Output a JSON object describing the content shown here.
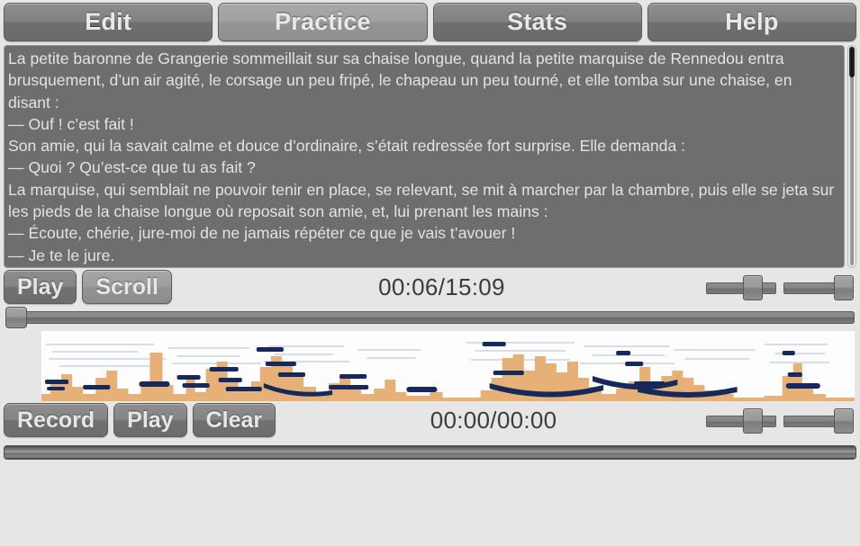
{
  "tabs": [
    {
      "label": "Edit",
      "active": false
    },
    {
      "label": "Practice",
      "active": true
    },
    {
      "label": "Stats",
      "active": false
    },
    {
      "label": "Help",
      "active": false
    }
  ],
  "reading_panel": {
    "text": "La petite baronne de Grangerie sommeillait sur sa chaise longue, quand la petite marquise de Rennedou entra brusquement, d’un air agité, le corsage un peu fripé, le chapeau un peu tourné, et elle tomba sur une chaise, en disant :\n— Ouf ! c’est fait !\nSon amie, qui la savait calme et douce d’ordinaire, s’était redressée fort surprise. Elle demanda :\n— Quoi ? Qu’est-ce que tu as fait ?\nLa marquise, qui semblait ne pouvoir tenir en place, se relevant, se mit à marcher par la chambre, puis elle se jeta sur les pieds de la chaise longue où reposait son amie, et, lui prenant les mains :\n— Écoute, chérie, jure-moi de ne jamais répéter ce que je vais t’avouer !\n— Je te le jure.\n— Sur ton salut éternel ?",
    "scrollbar_position_percent": 2
  },
  "playback_row": {
    "play_label": "Play",
    "scroll_label": "Scroll",
    "time": "00:06/15:09",
    "slider_a_percent": 55,
    "slider_b_percent": 100
  },
  "seek_slider": {
    "position_percent": 0
  },
  "record_row": {
    "record_label": "Record",
    "play_label": "Play",
    "clear_label": "Clear",
    "time": "00:00/00:00",
    "slider_a_percent": 55,
    "slider_b_percent": 100
  },
  "bottom_slider": {
    "position_percent": 0
  },
  "colors": {
    "background": "#e6e6e6",
    "text_panel": "#6e6e6e",
    "button_face": "#828282",
    "button_active": "#a0a0a0",
    "spectro_energy": "#e7b077",
    "spectro_pitch": "#16295c"
  }
}
